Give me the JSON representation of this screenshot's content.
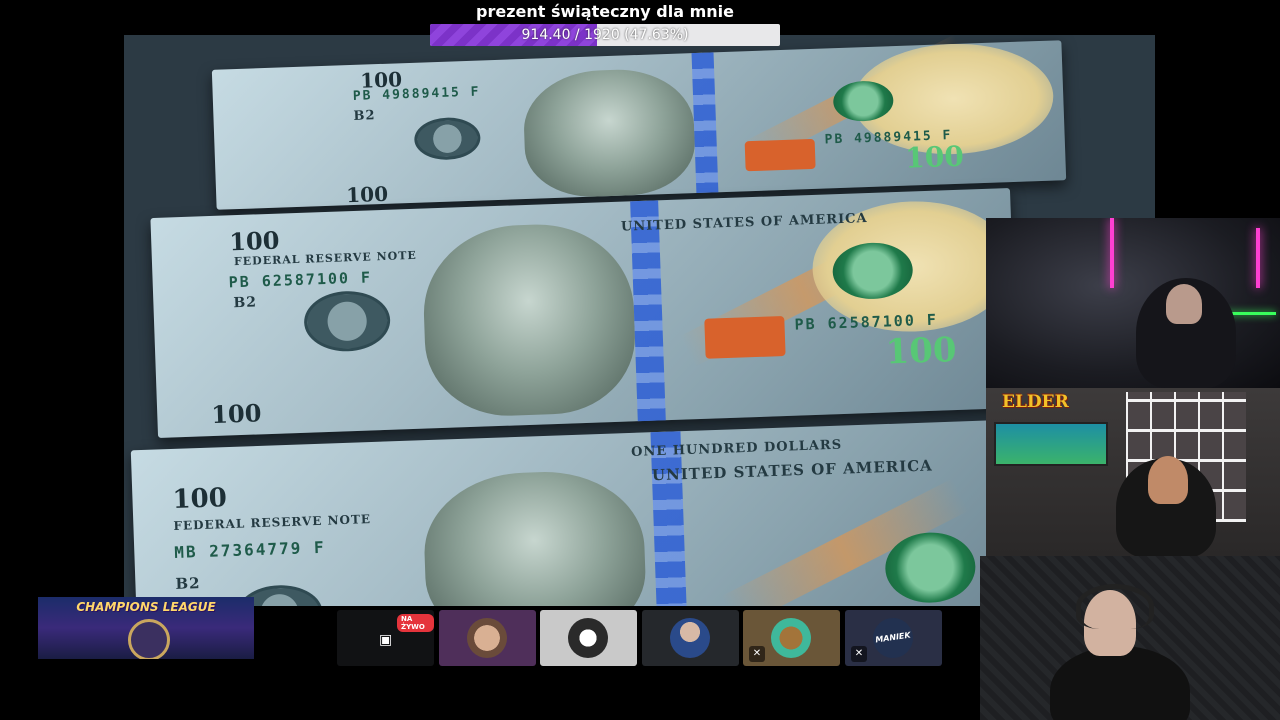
{
  "goal": {
    "title": "prezent świąteczny dla mnie",
    "progress_text": "914.40 / 1920 (47.63%)",
    "fraction": 0.4763,
    "fill_color": "#7c32c8"
  },
  "main_screen": {
    "bills": [
      {
        "serial": "PB 49889415 F",
        "value": "100"
      },
      {
        "serial": "PB 62587100 F",
        "value": "100"
      },
      {
        "serial": "MB 27364779 F",
        "value": "100"
      }
    ],
    "header_text": "FEDERAL RESERVE NOTE",
    "country_text": "UNITED STATES OF AMERICA",
    "denomination_text": "ONE HUNDRED DOLLARS",
    "seal_label": "B2"
  },
  "webcams": {
    "cam2_logo": "ELDER"
  },
  "overlay_thumb": {
    "title": "CHAMPIONS LEAGUE"
  },
  "participants": [
    {
      "kind": "screen",
      "badge": "NA ŻYWO",
      "icon": "screen-share-icon"
    },
    {
      "kind": "avatar",
      "icon": "avatar-face"
    },
    {
      "kind": "avatar",
      "icon": "avatar-car"
    },
    {
      "kind": "avatar",
      "icon": "avatar-person"
    },
    {
      "kind": "avatar",
      "icon": "avatar-pixel",
      "muted": true
    },
    {
      "kind": "avatar",
      "name": "MANIEK",
      "muted": true
    }
  ],
  "colors": {
    "background": "#000000",
    "goal_track": "#e8e8ea",
    "live_badge": "#e5343c",
    "neon_pink": "#ff3fd2",
    "neon_green": "#39ff5c"
  }
}
